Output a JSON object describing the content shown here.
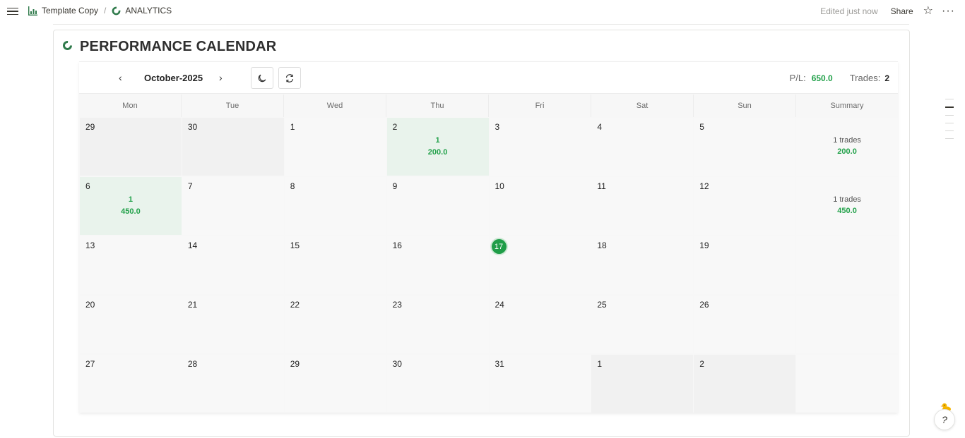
{
  "topbar": {
    "breadcrumb": [
      {
        "label": "Template Copy",
        "icon": "chart-icon"
      },
      {
        "label": "ANALYTICS",
        "icon": "pie-icon"
      }
    ],
    "separator": "/",
    "edited": "Edited just now",
    "share": "Share",
    "star_icon": "☆",
    "more_icon": "···"
  },
  "page": {
    "title": "PERFORMANCE CALENDAR"
  },
  "calendar": {
    "month": "October-2025",
    "prev_icon": "‹",
    "next_icon": "›",
    "pl_label": "P/L:",
    "pl_value": "650.0",
    "trades_label": "Trades:",
    "trades_value": "2",
    "days_of_week": [
      "Mon",
      "Tue",
      "Wed",
      "Thu",
      "Fri",
      "Sat",
      "Sun",
      "Summary"
    ],
    "weeks": [
      {
        "days": [
          {
            "day": "29",
            "muted": true
          },
          {
            "day": "30",
            "muted": true
          },
          {
            "day": "1"
          },
          {
            "day": "2",
            "trades": "1",
            "pl": "200.0"
          },
          {
            "day": "3"
          },
          {
            "day": "4"
          },
          {
            "day": "5"
          }
        ],
        "summary": {
          "trades": "1 trades",
          "pl": "200.0"
        }
      },
      {
        "days": [
          {
            "day": "6",
            "trades": "1",
            "pl": "450.0"
          },
          {
            "day": "7"
          },
          {
            "day": "8"
          },
          {
            "day": "9"
          },
          {
            "day": "10"
          },
          {
            "day": "11"
          },
          {
            "day": "12"
          }
        ],
        "summary": {
          "trades": "1 trades",
          "pl": "450.0"
        }
      },
      {
        "days": [
          {
            "day": "13"
          },
          {
            "day": "14"
          },
          {
            "day": "15"
          },
          {
            "day": "16"
          },
          {
            "day": "17",
            "today": true
          },
          {
            "day": "18"
          },
          {
            "day": "19"
          }
        ],
        "summary": {}
      },
      {
        "days": [
          {
            "day": "20"
          },
          {
            "day": "21"
          },
          {
            "day": "22"
          },
          {
            "day": "23"
          },
          {
            "day": "24"
          },
          {
            "day": "25"
          },
          {
            "day": "26"
          }
        ],
        "summary": {}
      },
      {
        "days": [
          {
            "day": "27"
          },
          {
            "day": "28"
          },
          {
            "day": "29"
          },
          {
            "day": "30"
          },
          {
            "day": "31"
          },
          {
            "day": "1",
            "muted": true
          },
          {
            "day": "2",
            "muted": true
          }
        ],
        "summary": {}
      }
    ]
  },
  "help": {
    "icon": "?"
  },
  "colors": {
    "profit": "#22a14a",
    "profit_bg": "#e9f3ec",
    "today": "#1f9d48"
  }
}
